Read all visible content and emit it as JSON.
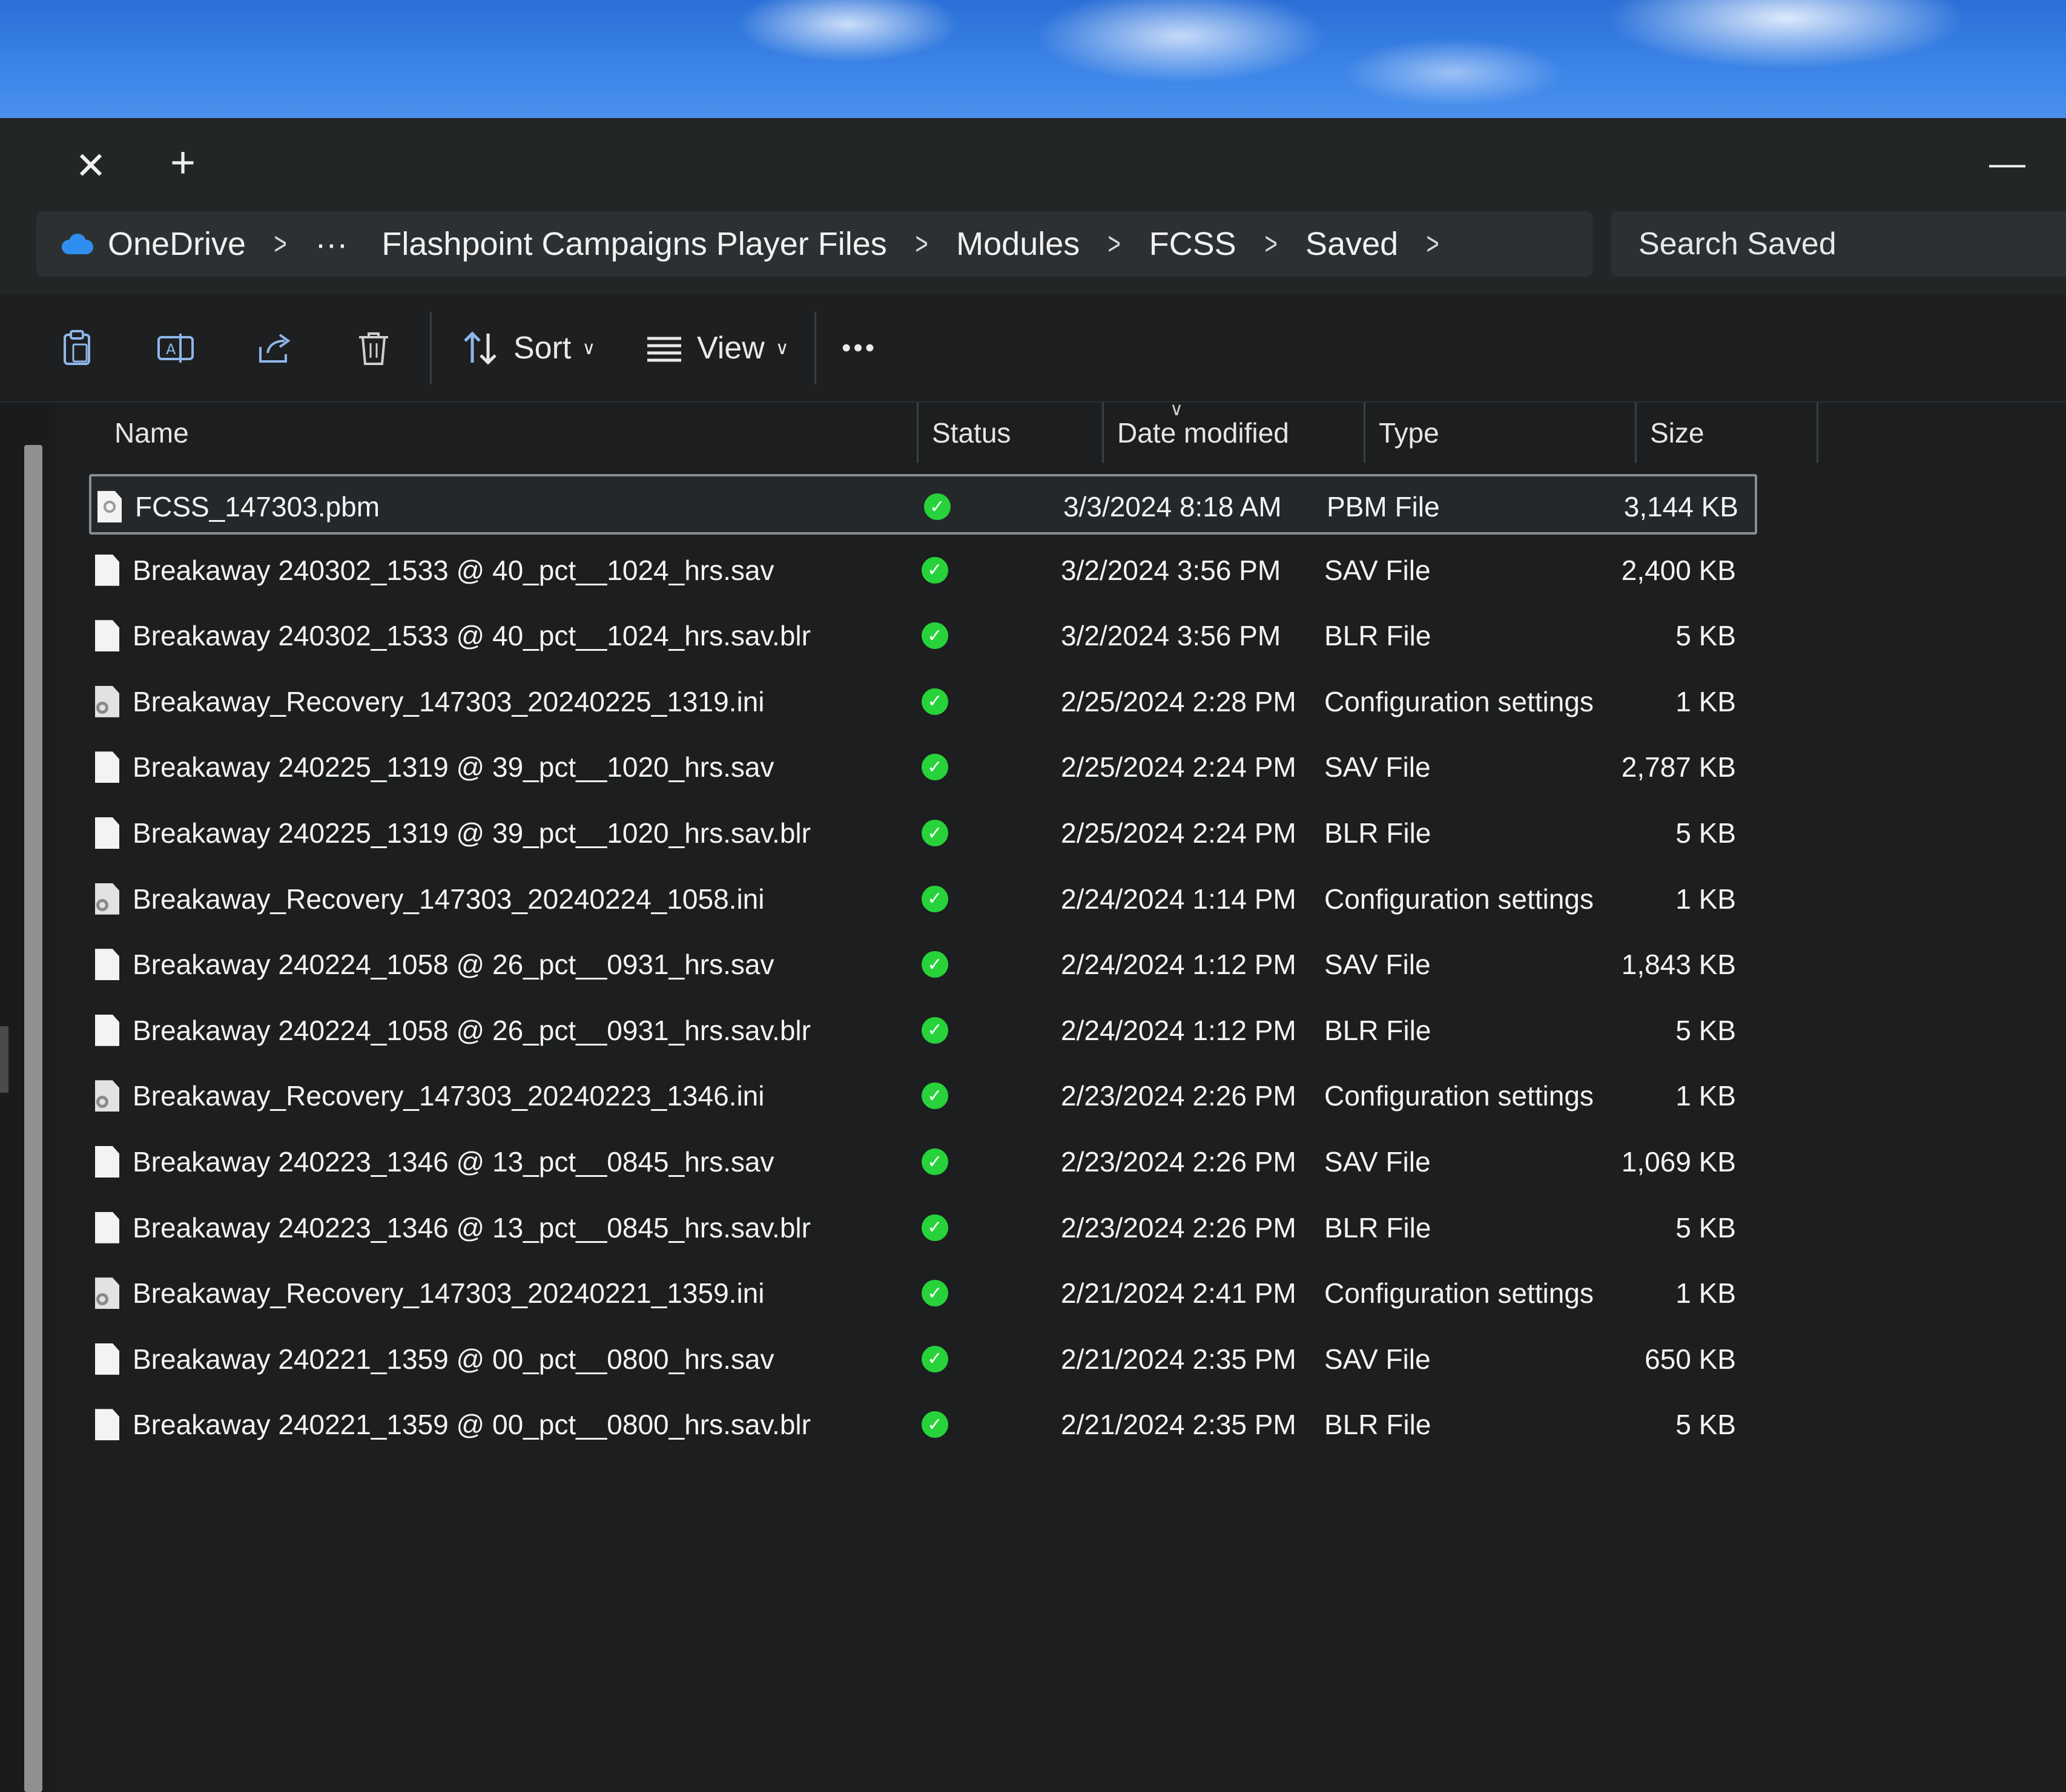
{
  "tabs": {
    "close_glyph": "✕",
    "new_glyph": "+"
  },
  "window": {
    "minimize_glyph": "—"
  },
  "breadcrumb": {
    "root": "OneDrive",
    "overflow": "···",
    "items": [
      "Flashpoint Campaigns Player Files",
      "Modules",
      "FCSS",
      "Saved"
    ]
  },
  "search": {
    "placeholder": "Search Saved"
  },
  "toolbar": {
    "sort_label": "Sort",
    "view_label": "View",
    "more_glyph": "•••"
  },
  "columns": {
    "name": "Name",
    "status": "Status",
    "date": "Date modified",
    "type": "Type",
    "size": "Size"
  },
  "files": [
    {
      "name": "FCSS_147303.pbm",
      "date": "3/3/2024 8:18 AM",
      "type": "PBM File",
      "size": "3,144 KB",
      "icon": "pbm-file-icon"
    },
    {
      "name": "Breakaway 240302_1533 @ 40_pct__1024_hrs.sav",
      "date": "3/2/2024 3:56 PM",
      "type": "SAV File",
      "size": "2,400 KB",
      "icon": "file-icon"
    },
    {
      "name": "Breakaway 240302_1533 @ 40_pct__1024_hrs.sav.blr",
      "date": "3/2/2024 3:56 PM",
      "type": "BLR File",
      "size": "5 KB",
      "icon": "file-icon"
    },
    {
      "name": "Breakaway_Recovery_147303_20240225_1319.ini",
      "date": "2/25/2024 2:28 PM",
      "type": "Configuration settings",
      "size": "1 KB",
      "icon": "settings-file-icon"
    },
    {
      "name": "Breakaway 240225_1319 @ 39_pct__1020_hrs.sav",
      "date": "2/25/2024 2:24 PM",
      "type": "SAV File",
      "size": "2,787 KB",
      "icon": "file-icon"
    },
    {
      "name": "Breakaway 240225_1319 @ 39_pct__1020_hrs.sav.blr",
      "date": "2/25/2024 2:24 PM",
      "type": "BLR File",
      "size": "5 KB",
      "icon": "file-icon"
    },
    {
      "name": "Breakaway_Recovery_147303_20240224_1058.ini",
      "date": "2/24/2024 1:14 PM",
      "type": "Configuration settings",
      "size": "1 KB",
      "icon": "settings-file-icon"
    },
    {
      "name": "Breakaway 240224_1058 @ 26_pct__0931_hrs.sav",
      "date": "2/24/2024 1:12 PM",
      "type": "SAV File",
      "size": "1,843 KB",
      "icon": "file-icon"
    },
    {
      "name": "Breakaway 240224_1058 @ 26_pct__0931_hrs.sav.blr",
      "date": "2/24/2024 1:12 PM",
      "type": "BLR File",
      "size": "5 KB",
      "icon": "file-icon"
    },
    {
      "name": "Breakaway_Recovery_147303_20240223_1346.ini",
      "date": "2/23/2024 2:26 PM",
      "type": "Configuration settings",
      "size": "1 KB",
      "icon": "settings-file-icon"
    },
    {
      "name": "Breakaway 240223_1346 @ 13_pct__0845_hrs.sav",
      "date": "2/23/2024 2:26 PM",
      "type": "SAV File",
      "size": "1,069 KB",
      "icon": "file-icon"
    },
    {
      "name": "Breakaway 240223_1346 @ 13_pct__0845_hrs.sav.blr",
      "date": "2/23/2024 2:26 PM",
      "type": "BLR File",
      "size": "5 KB",
      "icon": "file-icon"
    },
    {
      "name": "Breakaway_Recovery_147303_20240221_1359.ini",
      "date": "2/21/2024 2:41 PM",
      "type": "Configuration settings",
      "size": "1 KB",
      "icon": "settings-file-icon"
    },
    {
      "name": "Breakaway 240221_1359 @ 00_pct__0800_hrs.sav",
      "date": "2/21/2024 2:35 PM",
      "type": "SAV File",
      "size": "650 KB",
      "icon": "file-icon"
    },
    {
      "name": "Breakaway 240221_1359 @ 00_pct__0800_hrs.sav.blr",
      "date": "2/21/2024 2:35 PM",
      "type": "BLR File",
      "size": "5 KB",
      "icon": "file-icon"
    }
  ],
  "colors": {
    "status_synced": "#27d23a",
    "onedrive_blue": "#2f8ff0"
  }
}
